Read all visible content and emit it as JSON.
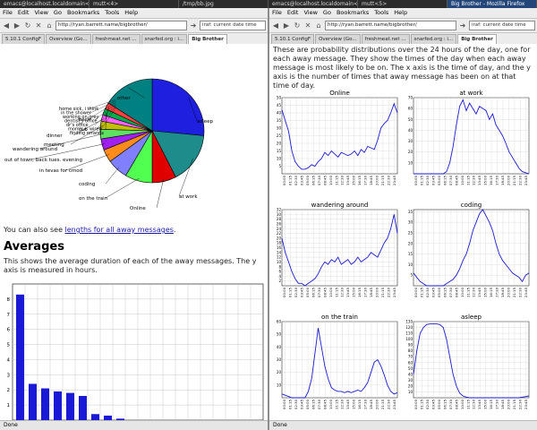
{
  "taskbar": [
    "emacs@localhost.localdomain<1>",
    "mutt<4>",
    "/tmp/bb.jpg",
    "emacs@localhost.localdomain<2>",
    "mutt<5>",
    "Big Brother - Mozilla Firefox"
  ],
  "left": {
    "menu": [
      "File",
      "Edit",
      "View",
      "Go",
      "Bookmarks",
      "Tools",
      "Help"
    ],
    "url": "http://ryan.barrett.name/bigbrother/",
    "search": "iraf: current date time",
    "tabs": [
      "5.10.1 ConfigF",
      "Overview (Go...",
      "freshmeat.net ...",
      "snarfed.org : i...",
      "Big Brother"
    ],
    "pie": {
      "title": "",
      "slices": [
        {
          "label": "asleep",
          "color": "#1f1fe0"
        },
        {
          "label": "at work",
          "color": "#1f8c8c"
        },
        {
          "label": "Online",
          "color": "#e00000"
        },
        {
          "label": "on the train",
          "color": "#50ff50"
        },
        {
          "label": "coding",
          "color": "#8080ff"
        },
        {
          "label": "in tevas for cmod",
          "color": "#ff8c1a"
        },
        {
          "label": "out of town, back tues. evening",
          "color": "#a020f0"
        },
        {
          "label": "wandering around",
          "color": "#60e060"
        },
        {
          "label": "meeting",
          "color": "#c0c000"
        },
        {
          "label": "dinner",
          "color": "#ff60ff"
        },
        {
          "label": "out",
          "color": "#00b050"
        },
        {
          "label": "back",
          "color": "#ff4040"
        },
        {
          "label": "other",
          "color": "#008080"
        }
      ],
      "crowded_labels": [
        "home sick, i think",
        "in the shower",
        "working on grey",
        "dentist's office",
        "dr's office",
        "mom's is wired",
        "finding errands"
      ]
    },
    "link_prefix": "You can also see ",
    "link_text": "lengths for all away messages",
    "link_suffix": ".",
    "heading": "Averages",
    "desc": "This shows the average duration of each of the away messages. The y axis is measured in hours.",
    "status": "Done",
    "chart_data": {
      "type": "bar",
      "ylim": [
        0,
        9
      ],
      "yticks": [
        "1",
        "2",
        "3",
        "4",
        "5",
        "6",
        "7",
        "8"
      ],
      "values": [
        8.3,
        2.4,
        2.1,
        1.9,
        1.8,
        1.6,
        0.4,
        0.3,
        0.1
      ]
    }
  },
  "right": {
    "menu": [
      "File",
      "Edit",
      "View",
      "Go",
      "Bookmarks",
      "Tools",
      "Help"
    ],
    "url": "http://ryan.barrett.name/bigbrother/",
    "search": "iraf: current date time",
    "tabs": [
      "5.10.1 ConfigF",
      "Overview (Go...",
      "freshmeat.net ...",
      "snarfed.org : i...",
      "Big Brother"
    ],
    "intro": "These are probability distributions over the 24 hours of the day, one for each away message. They show the times of the day when each away message is most likely to be on. The x axis is the time of day, and the y axis is the number of times that away message has been on at that time of day.",
    "status": "Done",
    "xticks": [
      "00:00",
      "01:15",
      "02:30",
      "03:45",
      "05:00",
      "06:15",
      "07:30",
      "08:45",
      "10:00",
      "11:15",
      "12:30",
      "13:45",
      "15:00",
      "16:15",
      "17:30",
      "18:45",
      "20:00",
      "21:15",
      "22:30",
      "23:45"
    ],
    "charts": [
      {
        "title": "Online",
        "ylim": [
          0,
          50
        ],
        "yticks": [
          "5",
          "10",
          "15",
          "20",
          "25",
          "30",
          "35",
          "40",
          "45",
          "50"
        ],
        "values": [
          42,
          35,
          28,
          15,
          8,
          5,
          3,
          3,
          4,
          6,
          5,
          8,
          10,
          14,
          12,
          15,
          13,
          11,
          14,
          13,
          12,
          13,
          15,
          12,
          16,
          14,
          18,
          17,
          16,
          22,
          30,
          33,
          35,
          40,
          46,
          40
        ]
      },
      {
        "title": "at work",
        "ylim": [
          0,
          70
        ],
        "yticks": [
          "10",
          "20",
          "30",
          "40",
          "50",
          "60",
          "70"
        ],
        "values": [
          0,
          0,
          0,
          0,
          0,
          0,
          0,
          0,
          0,
          0,
          2,
          10,
          25,
          45,
          62,
          68,
          58,
          65,
          60,
          55,
          62,
          60,
          58,
          50,
          55,
          45,
          40,
          35,
          28,
          20,
          15,
          10,
          5,
          2,
          1,
          0
        ]
      },
      {
        "title": "wandering around",
        "ylim": [
          0,
          32
        ],
        "yticks": [
          "2",
          "4",
          "6",
          "8",
          "10",
          "12",
          "14",
          "16",
          "18",
          "20",
          "22",
          "24",
          "26",
          "28",
          "30",
          "32"
        ],
        "values": [
          20,
          14,
          10,
          6,
          3,
          1,
          1,
          0,
          1,
          2,
          3,
          5,
          8,
          10,
          9,
          11,
          10,
          12,
          9,
          10,
          11,
          9,
          10,
          12,
          10,
          11,
          12,
          14,
          13,
          12,
          15,
          18,
          20,
          24,
          30,
          22
        ]
      },
      {
        "title": "coding",
        "ylim": [
          0,
          36
        ],
        "yticks": [
          "5",
          "10",
          "15",
          "20",
          "25",
          "30",
          "35"
        ],
        "values": [
          6,
          4,
          2,
          1,
          0,
          0,
          0,
          0,
          0,
          0,
          1,
          2,
          3,
          5,
          8,
          12,
          15,
          20,
          26,
          30,
          34,
          36,
          33,
          30,
          26,
          20,
          15,
          12,
          10,
          8,
          6,
          5,
          4,
          2,
          5,
          6
        ]
      },
      {
        "title": "on the train",
        "ylim": [
          0,
          60
        ],
        "yticks": [
          "10",
          "20",
          "30",
          "40",
          "50",
          "60"
        ],
        "values": [
          3,
          2,
          1,
          0,
          0,
          0,
          0,
          0,
          5,
          15,
          35,
          55,
          40,
          25,
          15,
          8,
          6,
          5,
          5,
          4,
          5,
          4,
          5,
          6,
          5,
          8,
          12,
          20,
          28,
          30,
          25,
          18,
          10,
          5,
          3,
          4
        ]
      },
      {
        "title": "asleep",
        "ylim": [
          0,
          130
        ],
        "yticks": [
          "10",
          "20",
          "30",
          "40",
          "50",
          "60",
          "70",
          "80",
          "90",
          "100",
          "110",
          "120",
          "130"
        ],
        "values": [
          40,
          80,
          110,
          120,
          125,
          126,
          126,
          126,
          125,
          120,
          100,
          70,
          40,
          20,
          8,
          3,
          1,
          0,
          0,
          0,
          0,
          0,
          0,
          0,
          0,
          0,
          0,
          0,
          0,
          0,
          0,
          0,
          0,
          1,
          2,
          3
        ]
      }
    ]
  }
}
